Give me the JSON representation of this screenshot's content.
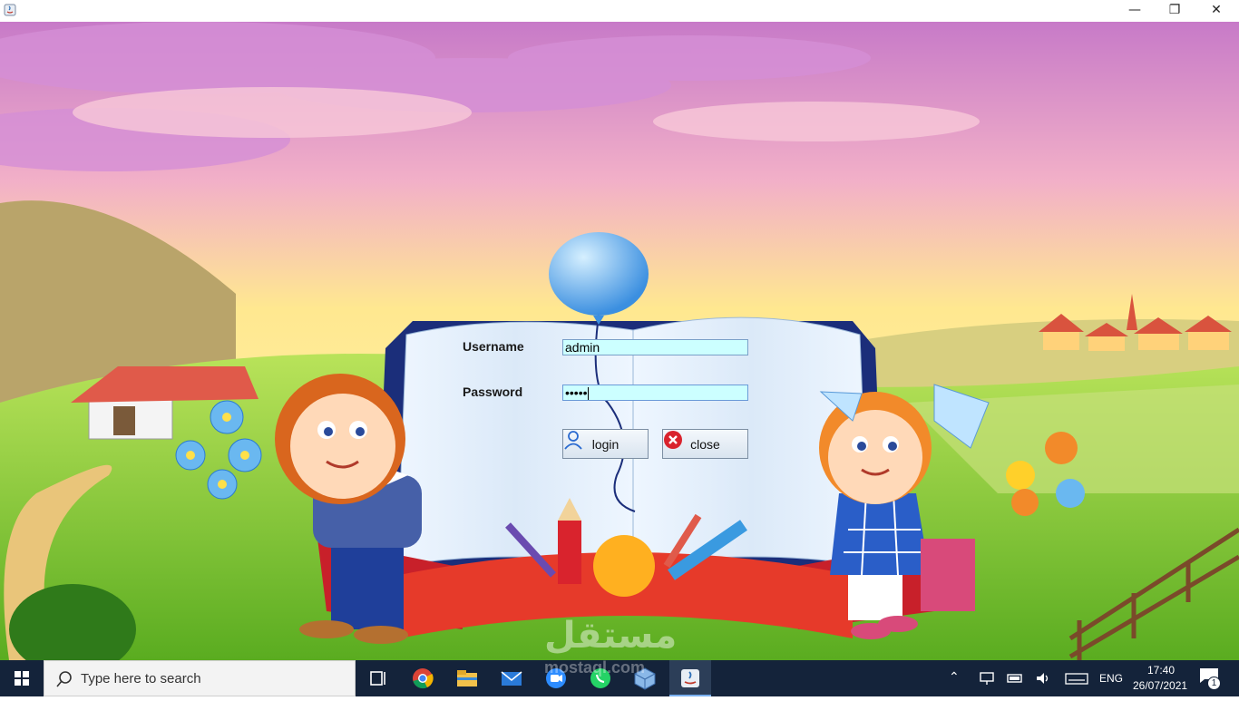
{
  "window": {
    "title": "",
    "controls": {
      "minimize": "—",
      "maximize": "❐",
      "close": "✕"
    }
  },
  "login_form": {
    "username_label": "Username",
    "username_value": "admin",
    "password_label": "Password",
    "password_value": "•••••",
    "login_label": "login",
    "close_label": "close"
  },
  "watermark": {
    "arabic": "مستقل",
    "url": "mostaql.com"
  },
  "taskbar": {
    "search_placeholder": "Type here to search",
    "pinned": [
      "task-view-icon",
      "chrome-icon",
      "file-explorer-icon",
      "mail-icon",
      "zoom-icon",
      "whatsapp-icon",
      "virtualbox-icon",
      "java-icon"
    ],
    "tray": {
      "language": "ENG",
      "time": "17:40",
      "date": "26/07/2021",
      "notification_count": "1"
    }
  },
  "colors": {
    "taskbar_bg": "#14233a",
    "field_bg": "#ccffff",
    "close_icon_red": "#d9232d",
    "sky_top": "#e8a0d0",
    "sky_bottom": "#fff3a0",
    "grass": "#7cc832"
  }
}
